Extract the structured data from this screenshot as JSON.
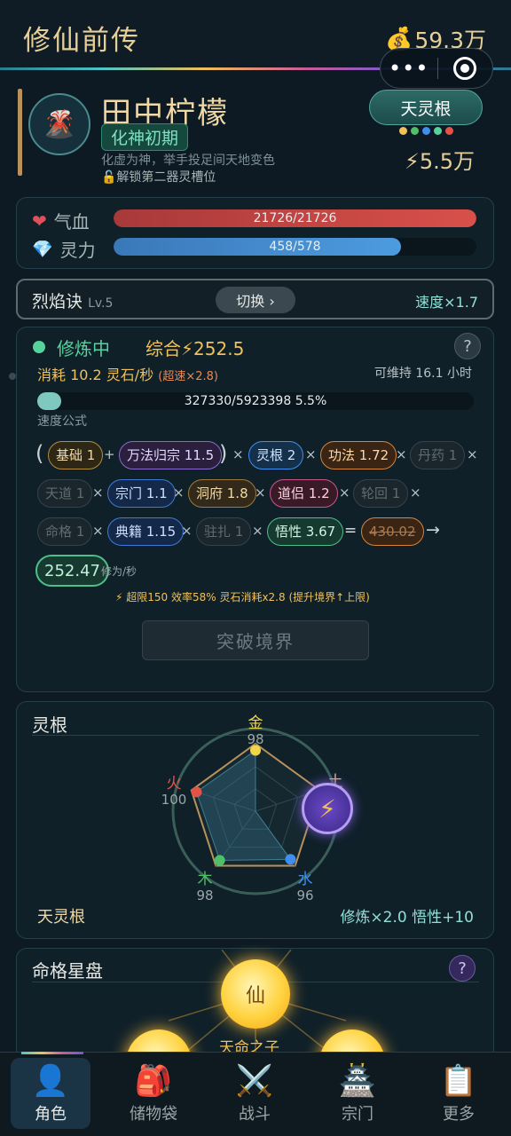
{
  "header": {
    "title": "修仙前传",
    "coin_icon": "money-bag-icon",
    "coins": "59.3万"
  },
  "capsule": {
    "more": "•••",
    "close_icon": "target-icon"
  },
  "profile": {
    "avatar_icon": "volcano-icon",
    "name": "田中柠檬",
    "realm": "化神初期",
    "description": "化虚为神，举手投足间天地变色",
    "unlock_hint": "🔓解锁第二器灵槽位",
    "root_button": "天灵根",
    "root_dot_colors": [
      "#f0c05a",
      "#4fbf6a",
      "#3f8ef0",
      "#56d39b",
      "#e2534a"
    ],
    "power": "⚡5.5万"
  },
  "stats": {
    "hp": {
      "icon": "heart-icon",
      "label": "气血",
      "text": "21726/21726",
      "fraction": 1.0,
      "color": "#d9504a"
    },
    "mp": {
      "icon": "diamond-icon",
      "label": "灵力",
      "text": "458/578",
      "fraction": 0.792,
      "color": "#4d9be0"
    }
  },
  "skill": {
    "name": "烈焰诀",
    "level": "Lv.5",
    "switch": "切换 ›",
    "speed": "速度×1.7"
  },
  "cultivation": {
    "status": "修炼中",
    "total": "综合⚡252.5",
    "help": "?",
    "consume_main": "消耗 10.2 灵石/秒",
    "consume_extra": "(超速×2.8)",
    "sustain": "可维持 16.1 小时",
    "progress_text": "327330/5923398  5.5%",
    "progress_fraction": 0.055,
    "formula_label": "速度公式",
    "formula": {
      "base": "基础 1",
      "method": "万法归宗 11.5",
      "root": "灵根 2",
      "skill": "功法 1.72",
      "pill": "丹药 1",
      "dao": "天道 1",
      "sect": "宗门 1.1",
      "cave": "洞府 1.8",
      "partner": "道侣 1.2",
      "rebirth": "轮回 1",
      "fate": "命格 1",
      "book": "典籍 1.15",
      "camp": "驻扎 1",
      "wisdom": "悟性 3.67",
      "raw": "430.02",
      "arrow": "→",
      "result": "252.47",
      "unit": "修为/秒",
      "plus": "+",
      "times": "×",
      "eq": "=",
      "lp": "(",
      "rp": ")"
    },
    "note": "⚡ 超限150 效率58% 灵石消耗x2.8 (提升境界↑上限)",
    "breakthrough": "突破境界"
  },
  "roots": {
    "title": "灵根",
    "elements": [
      {
        "name": "金",
        "value": 98,
        "color": "#f0d44a"
      },
      {
        "name": "土",
        "value": 0,
        "color": "#f0b07a"
      },
      {
        "name": "水",
        "value": 96,
        "color": "#3f8ef0"
      },
      {
        "name": "木",
        "value": 98,
        "color": "#4fbf6a"
      },
      {
        "name": "火",
        "value": 100,
        "color": "#e2534a"
      }
    ],
    "name": "天灵根",
    "bonus": "修炼×2.0  悟性+10",
    "lightning_icon": "⚡"
  },
  "stars": {
    "title": "命格星盘",
    "help": "?",
    "center": "仙",
    "destiny": "天命之子"
  },
  "nav": [
    {
      "icon": "👤",
      "label": "角色"
    },
    {
      "icon": "🎒",
      "label": "储物袋"
    },
    {
      "icon": "⚔️",
      "label": "战斗"
    },
    {
      "icon": "🏯",
      "label": "宗门"
    },
    {
      "icon": "📋",
      "label": "更多"
    }
  ]
}
